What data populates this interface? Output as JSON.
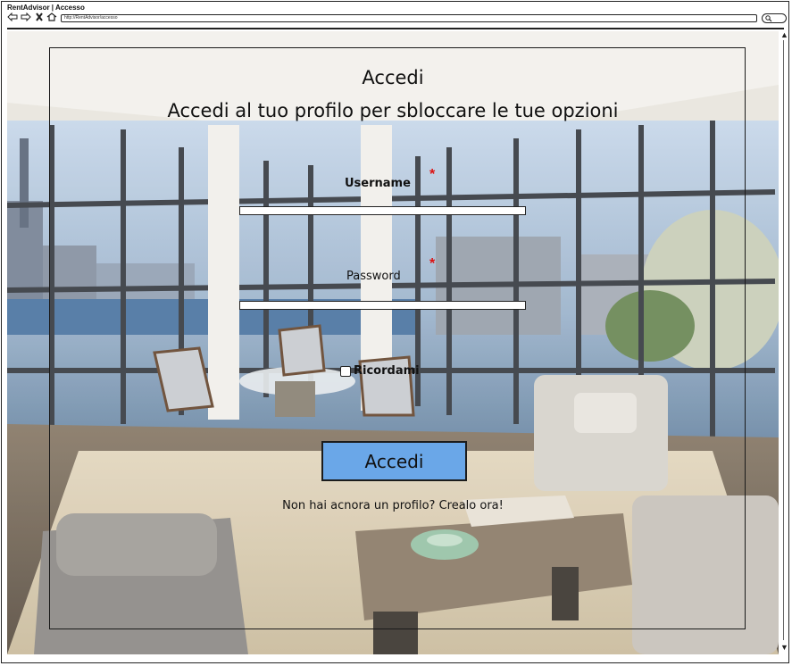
{
  "window": {
    "title": "RentAdvisor | Accesso",
    "url": "http://RentAdvisor/accesso"
  },
  "login": {
    "heading": "Accedi",
    "subheading": "Accedi al tuo profilo per sbloccare le tue opzioni",
    "username_label": "Username",
    "password_label": "Password",
    "required_marker": "*",
    "username_value": "",
    "password_value": "",
    "remember_label": "Ricordami",
    "remember_checked": false,
    "submit_label": "Accedi",
    "signup_prompt": "Non hai acnora un profilo?",
    "signup_link": "Crealo ora!"
  },
  "colors": {
    "button": "#6aa7e8",
    "required": "#dd1111"
  },
  "icons": [
    "back-arrow-icon",
    "forward-arrow-icon",
    "close-icon",
    "home-icon",
    "search-icon",
    "scroll-up-icon",
    "scroll-down-icon"
  ]
}
